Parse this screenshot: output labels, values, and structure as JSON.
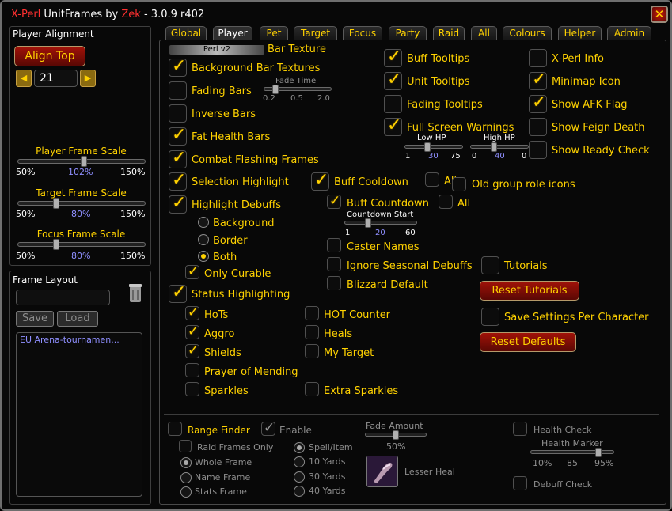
{
  "window": {
    "title_prefix": "X-Perl",
    "title_mid": "UnitFrames by",
    "author": "Zek",
    "title_suffix": "- 3.0.9 r402",
    "close_glyph": "✕"
  },
  "sidebar": {
    "alignment": {
      "heading": "Player Alignment",
      "align_button": "Align Top",
      "value": "21",
      "left_arrow": "◀",
      "right_arrow": "▶"
    },
    "player_scale": {
      "label": "Player Frame Scale",
      "min": "50%",
      "value": "102%",
      "max": "150%",
      "fraction": 0.52
    },
    "target_scale": {
      "label": "Target Frame Scale",
      "min": "50%",
      "value": "80%",
      "max": "150%",
      "fraction": 0.3
    },
    "focus_scale": {
      "label": "Focus Frame Scale",
      "min": "50%",
      "value": "80%",
      "max": "150%",
      "fraction": 0.3
    },
    "frame_layout": {
      "heading": "Frame Layout",
      "name_value": "",
      "save": "Save",
      "load": "Load",
      "list": [
        "EU Arena-tournamen..."
      ]
    }
  },
  "tabs": [
    {
      "label": "Global",
      "active": false
    },
    {
      "label": "Player",
      "active": true
    },
    {
      "label": "Pet",
      "active": false
    },
    {
      "label": "Target",
      "active": false
    },
    {
      "label": "Focus",
      "active": false
    },
    {
      "label": "Party",
      "active": false
    },
    {
      "label": "Raid",
      "active": false
    },
    {
      "label": "All",
      "active": false
    },
    {
      "label": "Colours",
      "active": false
    },
    {
      "label": "Helper",
      "active": false
    },
    {
      "label": "Admin",
      "active": false
    }
  ],
  "player": {
    "bar_texture": {
      "preview": "Perl v2",
      "label": "Bar Texture"
    },
    "background_bar_textures": {
      "label": "Background Bar Textures",
      "checked": true
    },
    "fading_bars": {
      "label": "Fading Bars",
      "checked": false
    },
    "fade_time": {
      "label": "Fade Time",
      "min": "0.2",
      "value": "0.5",
      "max": "2.0",
      "fraction": 0.17
    },
    "inverse_bars": {
      "label": "Inverse Bars",
      "checked": false
    },
    "fat_health_bars": {
      "label": "Fat Health Bars",
      "checked": true
    },
    "combat_flashing": {
      "label": "Combat Flashing Frames",
      "checked": true
    },
    "selection_highlight": {
      "label": "Selection Highlight",
      "checked": true
    },
    "highlight_debuffs": {
      "label": "Highlight Debuffs",
      "checked": true
    },
    "debuff_modes": [
      {
        "label": "Background",
        "selected": false
      },
      {
        "label": "Border",
        "selected": false
      },
      {
        "label": "Both",
        "selected": true
      }
    ],
    "only_curable": {
      "label": "Only Curable",
      "checked": true
    },
    "status_highlighting": {
      "label": "Status Highlighting",
      "checked": true
    },
    "hots": {
      "label": "HoTs",
      "checked": true
    },
    "aggro": {
      "label": "Aggro",
      "checked": true
    },
    "shields": {
      "label": "Shields",
      "checked": true
    },
    "prayer_of_mending": {
      "label": "Prayer of Mending",
      "checked": false
    },
    "sparkles": {
      "label": "Sparkles",
      "checked": false
    },
    "hot_counter": {
      "label": "HOT Counter",
      "checked": false
    },
    "heals": {
      "label": "Heals",
      "checked": false
    },
    "my_target": {
      "label": "My Target",
      "checked": false
    },
    "extra_sparkles": {
      "label": "Extra Sparkles",
      "checked": false
    },
    "buff_cooldown": {
      "label": "Buff Cooldown",
      "checked": true
    },
    "buff_cooldown_all": {
      "label": "All",
      "checked": false
    },
    "old_group_role_icons": {
      "label": "Old group role icons",
      "checked": false
    },
    "buff_countdown": {
      "label": "Buff Countdown",
      "checked": true
    },
    "buff_countdown_all": {
      "label": "All",
      "checked": false
    },
    "countdown_start": {
      "label": "Countdown Start",
      "min": "1",
      "value": "20",
      "max": "60",
      "fraction": 0.32
    },
    "caster_names": {
      "label": "Caster Names",
      "checked": false
    },
    "ignore_seasonal": {
      "label": "Ignore Seasonal Debuffs",
      "checked": false
    },
    "blizzard_default": {
      "label": "Blizzard Default",
      "checked": false
    },
    "buff_tooltips": {
      "label": "Buff Tooltips",
      "checked": true
    },
    "unit_tooltips": {
      "label": "Unit Tooltips",
      "checked": true
    },
    "fading_tooltips": {
      "label": "Fading Tooltips",
      "checked": false
    },
    "full_screen_warnings": {
      "label": "Full Screen Warnings",
      "checked": true
    },
    "low_hp": {
      "label": "Low HP",
      "min": "1",
      "value": "30",
      "max": "75",
      "fraction": 0.39
    },
    "high_hp": {
      "label": "High HP",
      "min": "0",
      "value": "40",
      "max": "0",
      "fraction": 0.4
    },
    "xperl_info": {
      "label": "X-Perl Info",
      "checked": false
    },
    "minimap_icon": {
      "label": "Minimap Icon",
      "checked": true
    },
    "show_afk_flag": {
      "label": "Show AFK Flag",
      "checked": true
    },
    "show_feign_death": {
      "label": "Show Feign Death",
      "checked": false
    },
    "show_ready_check": {
      "label": "Show Ready Check",
      "checked": false
    },
    "tutorials": {
      "label": "Tutorials",
      "checked": false
    },
    "reset_tutorials": "Reset Tutorials",
    "save_per_character": {
      "label": "Save Settings Per Character",
      "checked": false
    },
    "reset_defaults": "Reset Defaults"
  },
  "range": {
    "range_finder": {
      "label": "Range Finder",
      "checked": false
    },
    "enable": {
      "label": "Enable",
      "checked": true
    },
    "raid_frames_only": {
      "label": "Raid Frames Only",
      "checked": false
    },
    "frame_modes": [
      {
        "label": "Whole Frame",
        "selected": true
      },
      {
        "label": "Name Frame",
        "selected": false
      },
      {
        "label": "Stats Frame",
        "selected": false
      }
    ],
    "range_modes": [
      {
        "label": "Spell/Item",
        "selected": true
      },
      {
        "label": "10 Yards",
        "selected": false
      },
      {
        "label": "30 Yards",
        "selected": false
      },
      {
        "label": "40 Yards",
        "selected": false
      }
    ],
    "fade_amount": {
      "label": "Fade Amount",
      "value": "50%",
      "fraction": 0.5
    },
    "spell_name": "Lesser Heal",
    "health_check": {
      "label": "Health Check",
      "checked": false
    },
    "health_marker": {
      "label": "Health Marker",
      "min": "10%",
      "value": "85",
      "max": "95%",
      "fraction": 0.82
    },
    "debuff_check": {
      "label": "Debuff Check",
      "checked": false
    }
  }
}
